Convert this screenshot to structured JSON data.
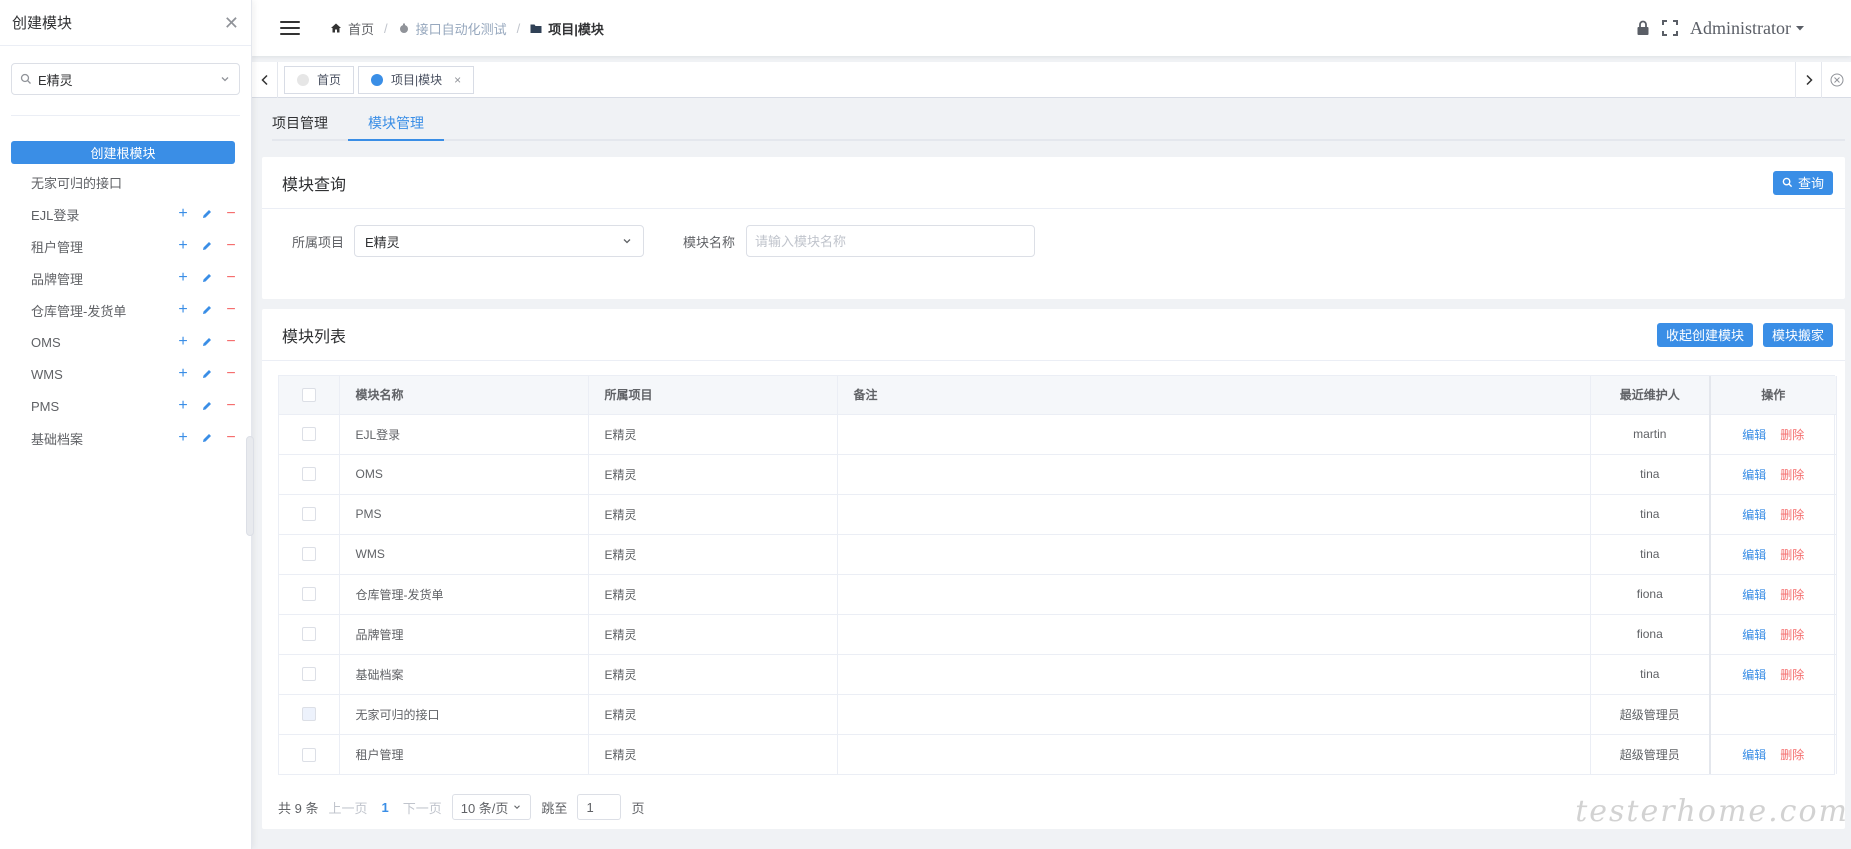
{
  "drawer": {
    "title": "创建模块",
    "project_select": "E精灵",
    "create_root_label": "创建根模块",
    "tree": [
      {
        "label": "无家可归的接口",
        "actions": false
      },
      {
        "label": "EJL登录",
        "actions": true
      },
      {
        "label": "租户管理",
        "actions": true
      },
      {
        "label": "品牌管理",
        "actions": true
      },
      {
        "label": "仓库管理-发货单",
        "actions": true
      },
      {
        "label": "OMS",
        "actions": true
      },
      {
        "label": "WMS",
        "actions": true
      },
      {
        "label": "PMS",
        "actions": true
      },
      {
        "label": "基础档案",
        "actions": true
      }
    ],
    "add_symbol": "+",
    "del_symbol": "−"
  },
  "header": {
    "breadcrumb": [
      "首页",
      "接口自动化测试",
      "项目|模块"
    ],
    "user": "Administrator"
  },
  "tags": [
    {
      "label": "首页",
      "active": false
    },
    {
      "label": "项目|模块",
      "active": true
    }
  ],
  "tag_close_symbol": "×",
  "subtabs": [
    "项目管理",
    "模块管理"
  ],
  "query": {
    "title": "模块查询",
    "search_button": "查询",
    "project_label": "所属项目",
    "project_value": "E精灵",
    "name_label": "模块名称",
    "name_placeholder": "请输入模块名称"
  },
  "list": {
    "title": "模块列表",
    "collapse_button": "收起创建模块",
    "move_button": "模块搬家",
    "columns": [
      "模块名称",
      "所属项目",
      "备注",
      "最近维护人",
      "操作"
    ],
    "edit_label": "编辑",
    "delete_label": "删除",
    "rows": [
      {
        "name": "EJL登录",
        "project": "E精灵",
        "remark": "",
        "maintainer": "martin",
        "ops": true
      },
      {
        "name": "OMS",
        "project": "E精灵",
        "remark": "",
        "maintainer": "tina",
        "ops": true
      },
      {
        "name": "PMS",
        "project": "E精灵",
        "remark": "",
        "maintainer": "tina",
        "ops": true
      },
      {
        "name": "WMS",
        "project": "E精灵",
        "remark": "",
        "maintainer": "tina",
        "ops": true
      },
      {
        "name": "仓库管理-发货单",
        "project": "E精灵",
        "remark": "",
        "maintainer": "fiona",
        "ops": true
      },
      {
        "name": "品牌管理",
        "project": "E精灵",
        "remark": "",
        "maintainer": "fiona",
        "ops": true
      },
      {
        "name": "基础档案",
        "project": "E精灵",
        "remark": "",
        "maintainer": "tina",
        "ops": true
      },
      {
        "name": "无家可归的接口",
        "project": "E精灵",
        "remark": "",
        "maintainer": "超级管理员",
        "ops": false
      },
      {
        "name": "租户管理",
        "project": "E精灵",
        "remark": "",
        "maintainer": "超级管理员",
        "ops": true
      }
    ]
  },
  "pagination": {
    "total": "共 9 条",
    "prev": "上一页",
    "current": "1",
    "next": "下一页",
    "page_size": "10 条/页",
    "jump_label": "跳至",
    "jump_value": "1",
    "page_suffix": "页"
  },
  "watermark": "testerhome.com"
}
